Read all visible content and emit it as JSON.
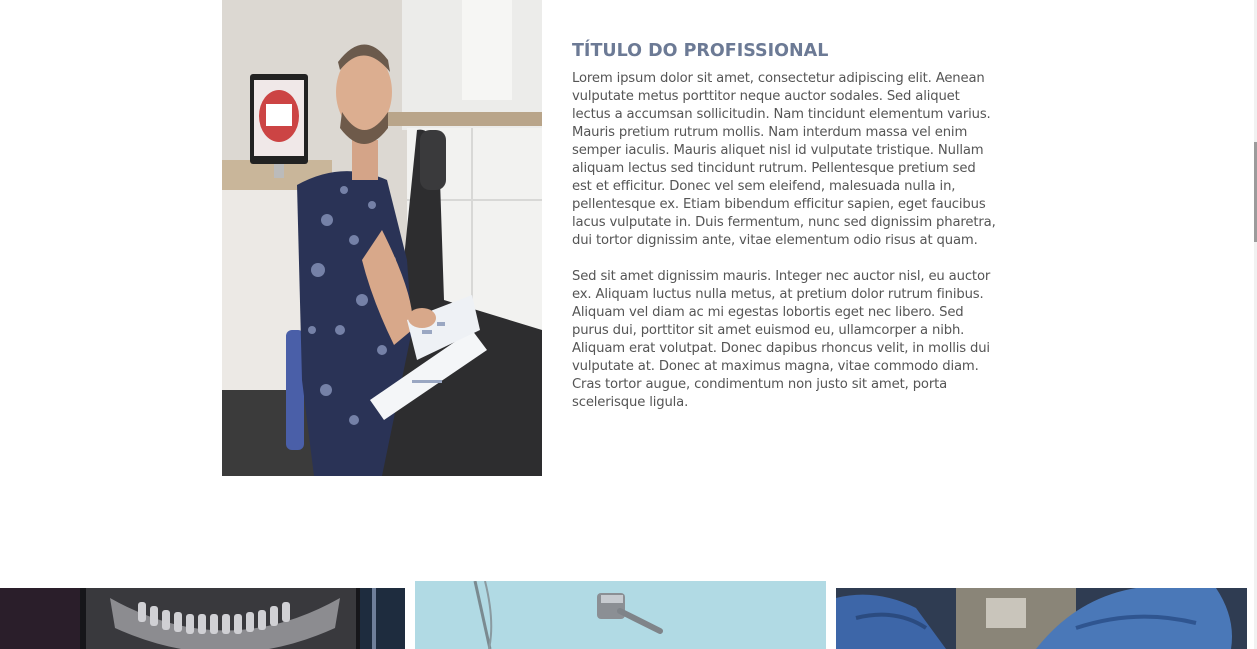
{
  "profile": {
    "title": "TÍTULO DO PROFISSIONAL",
    "paragraphs": [
      "Lorem ipsum dolor sit amet, consectetur adipiscing elit. Aenean vulputate metus porttitor neque auctor sodales. Sed aliquet lectus a accumsan sollicitudin. Nam tincidunt elementum varius. Mauris pretium rutrum mollis. Nam interdum massa vel enim semper iaculis. Mauris aliquet nisl id vulputate tristique. Nullam aliquam lectus sed tincidunt rutrum. Pellentesque pretium sed est et efficitur. Donec vel sem eleifend, malesuada nulla in, pellentesque ex. Etiam bibendum efficitur sapien, eget faucibus lacus vulputate in. Duis fermentum, nunc sed dignissim pharetra, dui tortor dignissim ante, vitae elementum odio risus at quam.",
      "Sed sit amet dignissim mauris. Integer nec auctor nisl, eu auctor ex. Aliquam luctus nulla metus, at pretium dolor rutrum finibus. Aliquam vel diam ac mi egestas lobortis eget nec libero. Sed purus dui, porttitor sit amet euismod eu, ullamcorper a nibh. Aliquam erat volutpat. Donec dapibus rhoncus velit, in mollis dui vulputate at. Donec at maximus magna, vitae commodo diam. Cras tortor augue, condimentum non justo sit amet, porta scelerisque ligula."
    ]
  },
  "colors": {
    "title": "#6c7a95",
    "body_text": "#555555",
    "background": "#ffffff"
  }
}
